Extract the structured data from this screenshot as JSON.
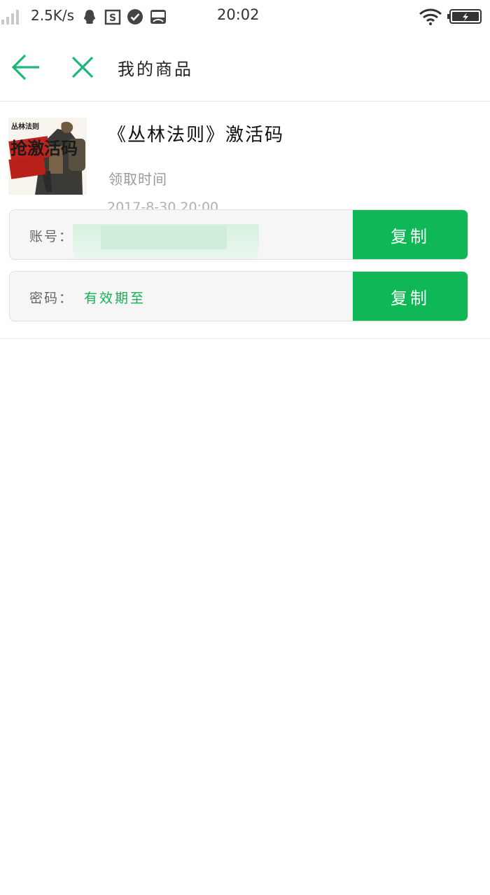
{
  "status_bar": {
    "net_speed": "2.5K/s",
    "time": "20:02",
    "icons": [
      "signal-icon",
      "qq-icon",
      "s-app-icon",
      "check-circle-icon",
      "vivo-app-icon",
      "wifi-icon",
      "battery-charging-icon"
    ]
  },
  "header": {
    "title": "我的商品",
    "back_icon": "arrow-left-icon",
    "close_icon": "close-icon",
    "accent_color": "#1db877"
  },
  "product": {
    "title": "《丛林法则》激活码",
    "time_label": "领取时间",
    "time_value": "2017-8-30 20:00",
    "image_overlay_text_top": "丛林法则",
    "image_overlay_text_main": "抢激活码"
  },
  "credentials": {
    "account_label": "账号：",
    "account_value": "",
    "password_label": "密码：",
    "password_value": "有效期至",
    "copy_label": "复制",
    "button_color": "#0fb756"
  }
}
